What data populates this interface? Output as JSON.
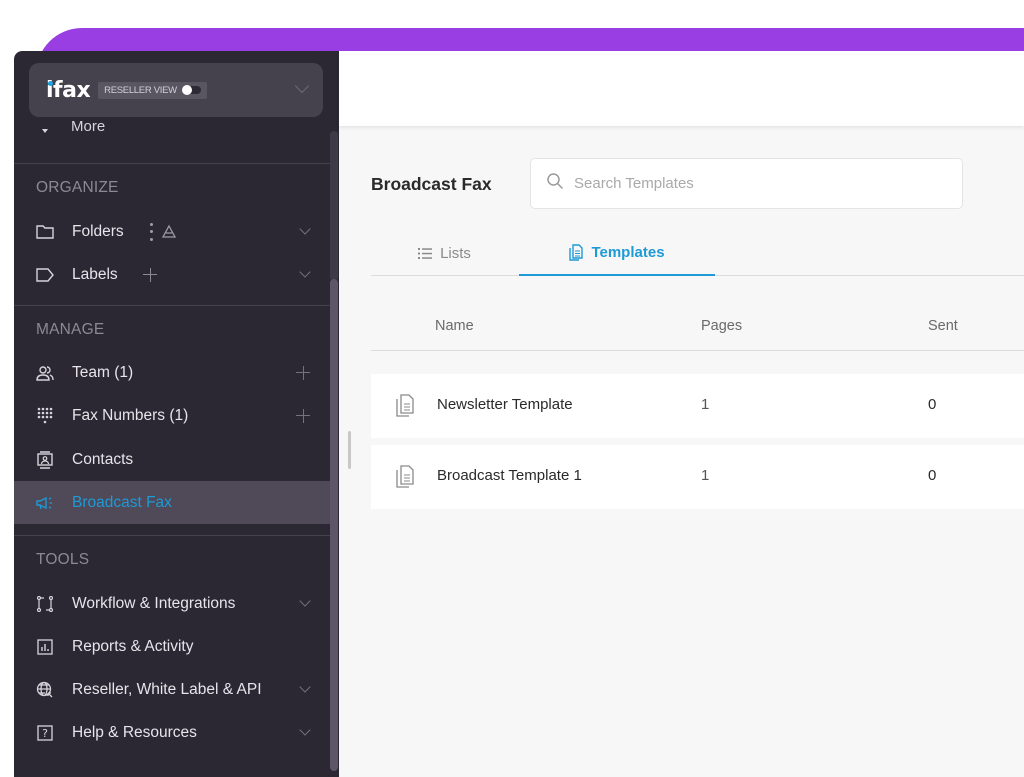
{
  "brand": {
    "logo_text": "ifax",
    "reseller_view_label": "RESELLER VIEW",
    "reseller_view_enabled": false
  },
  "sidebar": {
    "more_label": "More",
    "sections": [
      {
        "title": "ORGANIZE",
        "items": [
          {
            "label": "Folders",
            "icon": "folder-icon",
            "trailing": "chevron-down"
          },
          {
            "label": "Labels",
            "icon": "label-icon",
            "trailing": "chevron-down"
          }
        ]
      },
      {
        "title": "MANAGE",
        "items": [
          {
            "label": "Team (1)",
            "icon": "team-icon",
            "trailing": "plus"
          },
          {
            "label": "Fax Numbers (1)",
            "icon": "dialpad-icon",
            "trailing": "plus"
          },
          {
            "label": "Contacts",
            "icon": "contacts-icon",
            "trailing": null
          },
          {
            "label": "Broadcast Fax",
            "icon": "megaphone-icon",
            "trailing": null,
            "active": true
          }
        ]
      },
      {
        "title": "TOOLS",
        "items": [
          {
            "label": "Workflow & Integrations",
            "icon": "workflow-icon",
            "trailing": "chevron-down"
          },
          {
            "label": "Reports & Activity",
            "icon": "reports-icon",
            "trailing": null
          },
          {
            "label": "Reseller, White Label & API",
            "icon": "globe-icon",
            "trailing": "chevron-down"
          },
          {
            "label": "Help & Resources",
            "icon": "help-icon",
            "trailing": "chevron-down"
          }
        ]
      }
    ]
  },
  "main": {
    "title": "Broadcast Fax",
    "search": {
      "placeholder": "Search Templates",
      "value": ""
    },
    "tabs": [
      {
        "label": "Lists",
        "icon": "list-icon",
        "active": false
      },
      {
        "label": "Templates",
        "icon": "document-icon",
        "active": true
      }
    ],
    "table": {
      "columns": [
        "Name",
        "Pages",
        "Sent"
      ],
      "rows": [
        {
          "name": "Newsletter Template",
          "pages": "1",
          "sent": "0"
        },
        {
          "name": "Broadcast Template 1",
          "pages": "1",
          "sent": "0"
        }
      ]
    }
  },
  "colors": {
    "accent": "#1e9ad6",
    "brand_purple": "#983ee2",
    "sidebar_bg": "#2b2733",
    "sidebar_active_bg": "#4f4958"
  }
}
